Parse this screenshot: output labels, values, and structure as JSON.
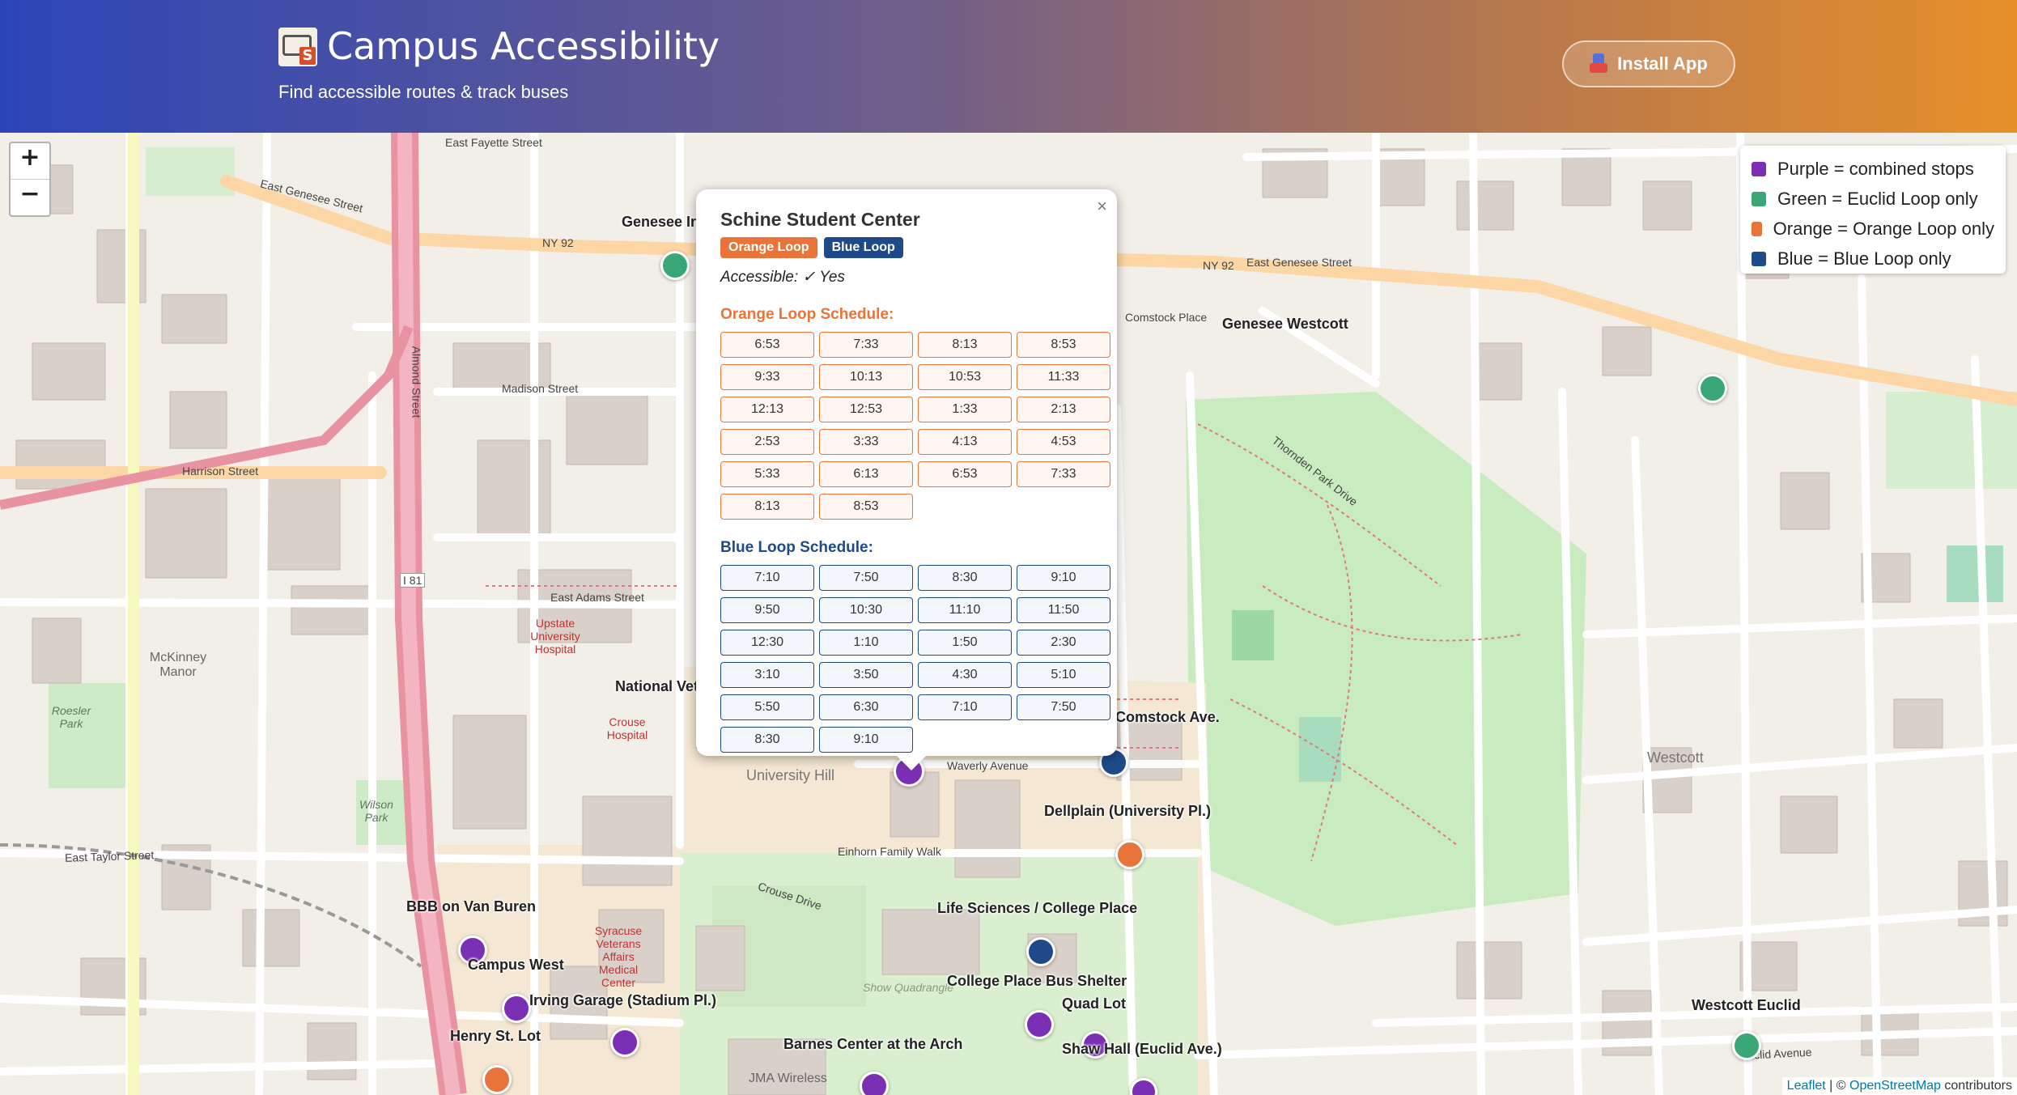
{
  "header": {
    "title": "Campus Accessibility",
    "subtitle": "Find accessible routes & track buses",
    "install_label": "Install App"
  },
  "zoom": {
    "in_label": "+",
    "out_label": "−"
  },
  "legend": [
    {
      "label": "Purple = combined stops",
      "color": "#7b2fb5"
    },
    {
      "label": "Green = Euclid Loop only",
      "color": "#3aa876"
    },
    {
      "label": "Orange = Orange Loop only",
      "color": "#e9743a"
    },
    {
      "label": "Blue = Blue Loop only",
      "color": "#1f4a8a"
    }
  ],
  "popup": {
    "close": "×",
    "title": "Schine Student Center",
    "badges": [
      "Orange Loop",
      "Blue Loop"
    ],
    "accessible": "Accessible: ✓ Yes",
    "orange_heading": "Orange Loop Schedule:",
    "orange_times": [
      "6:53",
      "7:33",
      "8:13",
      "8:53",
      "9:33",
      "10:13",
      "10:53",
      "11:33",
      "12:13",
      "12:53",
      "1:33",
      "2:13",
      "2:53",
      "3:33",
      "4:13",
      "4:53",
      "5:33",
      "6:13",
      "6:53",
      "7:33",
      "8:13",
      "8:53"
    ],
    "blue_heading": "Blue Loop Schedule:",
    "blue_times": [
      "7:10",
      "7:50",
      "8:30",
      "9:10",
      "9:50",
      "10:30",
      "11:10",
      "11:50",
      "12:30",
      "1:10",
      "1:50",
      "2:30",
      "3:10",
      "3:50",
      "4:30",
      "5:10",
      "5:50",
      "6:30",
      "7:10",
      "7:50",
      "8:30",
      "9:10"
    ]
  },
  "stops": {
    "genesee_irving": "Genesee Ir",
    "genesee_westcott": "Genesee Westcott",
    "comstock": "Comstock Ave.",
    "dellplain": "Dellplain (University Pl.)",
    "life_sciences": "Life Sciences / College Place",
    "college_place": "College Place Bus Shelter",
    "quad_lot": "Quad Lot",
    "shaw_hall": "Shaw Hall (Euclid Ave.)",
    "barnes": "Barnes Center at the Arch",
    "bbb": "BBB on Van Buren",
    "campus_west": "Campus West",
    "irving_garage": "Irving Garage (Stadium Pl.)",
    "henry_st": "Henry St. Lot",
    "westcott_euclid": "Westcott Euclid",
    "national_vet": "National Vet"
  },
  "map_labels": {
    "east_genesee": "East Genesee Street",
    "ny92": "NY 92",
    "harrison": "Harrison Street",
    "madison": "Madison Street",
    "adams": "East Adams Street",
    "taylor": "East Taylor Street",
    "waverly": "Waverly Avenue",
    "university_hill": "University Hill",
    "einhorn": "Einhorn Family Walk",
    "crouse_drive": "Crouse Drive",
    "show_quad": "Show Quadrangle",
    "upstate": "Upstate University Hospital",
    "crouse_hospital": "Crouse Hospital",
    "syracuse_va": "Syracuse Veterans Affairs Medical Center",
    "mckinney": "McKinney Manor",
    "roesler": "Roesler Park",
    "wilson": "Wilson Park",
    "westcott": "Westcott",
    "almond": "Almond Street",
    "i81": "I 81",
    "thornden": "Thornden Park Drive",
    "comstock_place": "Comstock Place",
    "jma": "JMA Wireless",
    "euclid": "Euclid Avenue",
    "east_fayette": "East Fayette Street"
  },
  "attribution": {
    "leaflet": "Leaflet",
    "sep": " | © ",
    "osm": "OpenStreetMap",
    "rest": " contributors"
  }
}
